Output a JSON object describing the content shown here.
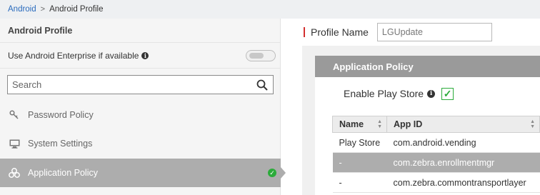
{
  "breadcrumb": {
    "root": "Android",
    "separator": ">",
    "current": "Android Profile"
  },
  "sidebar": {
    "title": "Android Profile",
    "enterprise_label": "Use Android Enterprise if available",
    "enterprise_toggle_on": false,
    "search_placeholder": "Search",
    "items": [
      {
        "label": "Password Policy",
        "icon": "key-icon",
        "active": false
      },
      {
        "label": "System Settings",
        "icon": "monitor-icon",
        "active": false
      },
      {
        "label": "Application Policy",
        "icon": "apps-icon",
        "active": true,
        "status": "check"
      }
    ]
  },
  "profile": {
    "label": "Profile Name",
    "value": "LGUpdate"
  },
  "policy": {
    "header": "Application Policy",
    "enable_play_store_label": "Enable Play Store",
    "enable_play_store_checked": true,
    "table": {
      "columns": [
        "Name",
        "App ID"
      ],
      "rows": [
        {
          "name": "Play Store",
          "app_id": "com.android.vending",
          "selected": false
        },
        {
          "name": "-",
          "app_id": "com.zebra.enrollmentmgr",
          "selected": true
        },
        {
          "name": "-",
          "app_id": "com.zebra.commontransportlayer",
          "selected": false
        }
      ]
    }
  },
  "colors": {
    "accent_green": "#2bab3a",
    "link_blue": "#2a6bbd",
    "required_red": "#d32f2f",
    "selected_gray": "#adadad"
  }
}
